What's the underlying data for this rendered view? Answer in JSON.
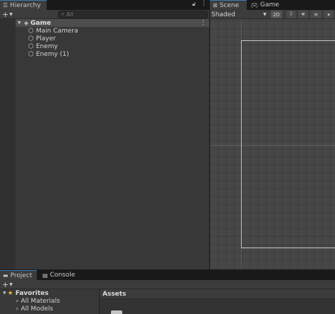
{
  "hierarchy": {
    "tab_label": "Hierarchy",
    "search_placeholder": "All",
    "scene_name": "Game",
    "objects": [
      {
        "label": "Main Camera"
      },
      {
        "label": "Player"
      },
      {
        "label": "Enemy"
      },
      {
        "label": "Enemy (1)"
      }
    ]
  },
  "scene_view": {
    "tabs": [
      {
        "label": "Scene"
      },
      {
        "label": "Game"
      }
    ],
    "shading_mode": "Shaded",
    "toggle_2d": "2D"
  },
  "project": {
    "tabs": [
      {
        "label": "Project"
      },
      {
        "label": "Console"
      }
    ],
    "favorites": {
      "label": "Favorites",
      "items": [
        {
          "label": "All Materials"
        },
        {
          "label": "All Models"
        }
      ]
    },
    "assets_header": "Assets"
  },
  "colors": {
    "accent": "#3a79bb",
    "favorites_star": "#e8b528"
  }
}
